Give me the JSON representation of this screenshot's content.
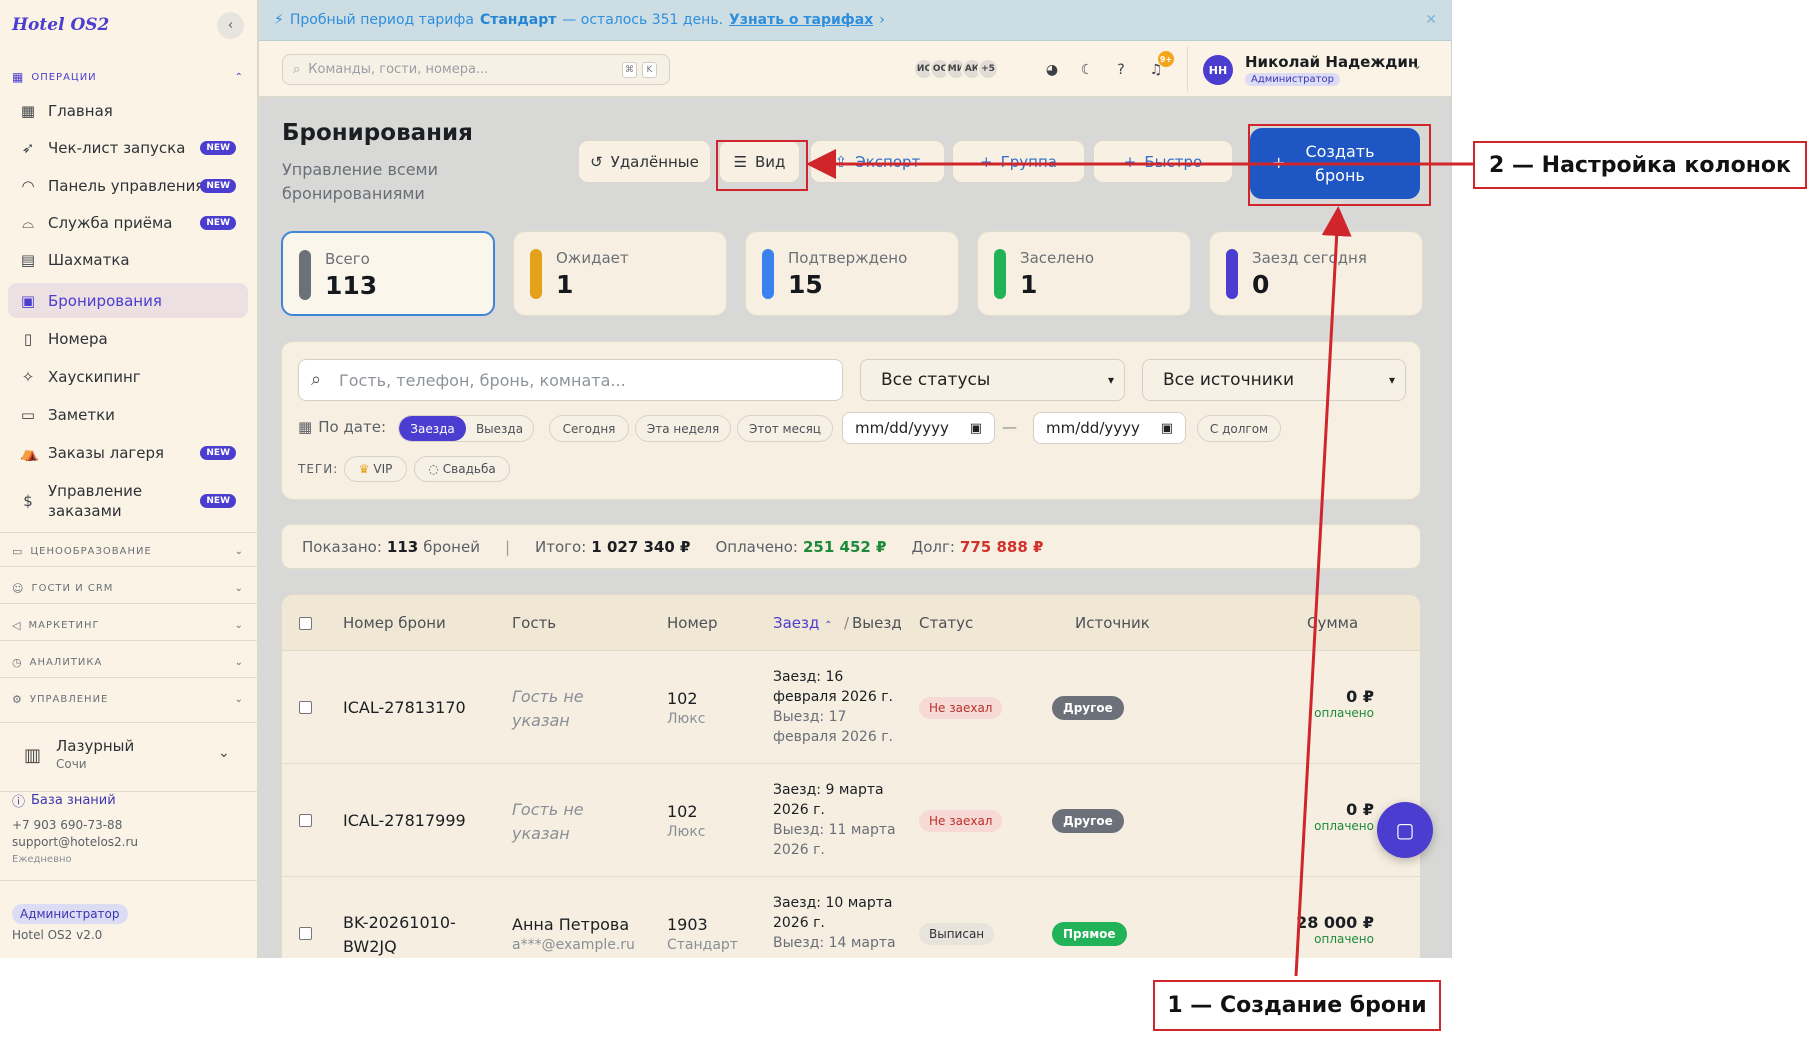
{
  "app": {
    "logo": "Hotel OS2",
    "version": "Hotel OS2 v2.0"
  },
  "sidebar": {
    "section_operations": "ОПЕРАЦИИ",
    "items": [
      {
        "label": "Главная",
        "icon": "grid-icon",
        "new": false
      },
      {
        "label": "Чек-лист запуска",
        "icon": "rocket-icon",
        "new": true
      },
      {
        "label": "Панель управления",
        "icon": "gauge-icon",
        "new": true
      },
      {
        "label": "Служба приёма",
        "icon": "bell-icon",
        "new": true
      },
      {
        "label": "Шахматка",
        "icon": "table-icon",
        "new": false
      },
      {
        "label": "Бронирования",
        "icon": "clipboard-icon",
        "new": false
      },
      {
        "label": "Номера",
        "icon": "door-icon",
        "new": false
      },
      {
        "label": "Хаускипинг",
        "icon": "sparkle-icon",
        "new": false
      },
      {
        "label": "Заметки",
        "icon": "note-icon",
        "new": false
      },
      {
        "label": "Заказы лагеря",
        "icon": "tent-icon",
        "new": true
      },
      {
        "label": "Управление заказами",
        "icon": "receipt-icon",
        "new": true
      }
    ],
    "new_badge": "NEW",
    "sections": [
      "ЦЕНООБРАЗОВАНИЕ",
      "ГОСТИ И CRM",
      "МАРКЕТИНГ",
      "АНАЛИТИКА",
      "УПРАВЛЕНИЕ"
    ],
    "hotel_name": "Лазурный",
    "hotel_city": "Сочи",
    "kb_label": "База знаний",
    "phone": "+7 903 690-73-88",
    "email": "support@hotelos2.ru",
    "hours": "Ежедневно",
    "role": "Администратор"
  },
  "trial": {
    "text": "Пробный период тарифа",
    "plan": "Стандарт",
    "rest": "— осталось 351 день.",
    "link": "Узнать о тарифах"
  },
  "topbar": {
    "command_placeholder": "Команды, гости, номера...",
    "kbd1": "⌘",
    "kbd2": "K",
    "avatars": [
      "ИС",
      "ОС",
      "МИ",
      "АК",
      "+5"
    ],
    "notif_count": "9+",
    "user_initials": "НН",
    "user_name": "Николай Надеждин",
    "user_role": "Администратор"
  },
  "page": {
    "title": "Бронирования",
    "subtitle": "Управление всеми бронированиями",
    "btn_deleted": "Удалённые",
    "btn_view": "Вид",
    "btn_export": "Экспорт",
    "btn_group": "Группа",
    "btn_quick": "Быстро",
    "btn_create": "Создать бронь"
  },
  "stats": [
    {
      "label": "Всего",
      "value": "113",
      "color": "#6b7079"
    },
    {
      "label": "Ожидает",
      "value": "1",
      "color": "#e3a21a"
    },
    {
      "label": "Подтверждено",
      "value": "15",
      "color": "#3b82f0"
    },
    {
      "label": "Заселено",
      "value": "1",
      "color": "#22b257"
    },
    {
      "label": "Заезд сегодня",
      "value": "0",
      "color": "#4b3dcf"
    }
  ],
  "filters": {
    "search_placeholder": "Гость, телефон, бронь, комната...",
    "status": "Все статусы",
    "source": "Все источники",
    "by_date": "По дате:",
    "seg_in": "Заезда",
    "seg_out": "Выезда",
    "today": "Сегодня",
    "week": "Эта неделя",
    "month": "Этот месяц",
    "date_from": "mm/dd/yyyy",
    "date_to": "mm/dd/yyyy",
    "debt": "С долгом",
    "tags_label": "ТЕГИ:",
    "tag_vip": "VIP",
    "tag_wedding": "Свадьба"
  },
  "summary": {
    "shown_label": "Показано:",
    "shown_count": "113",
    "shown_unit": "броней",
    "total_label": "Итого:",
    "total": "1 027 340 ₽",
    "paid_label": "Оплачено:",
    "paid": "251 452 ₽",
    "debt_label": "Долг:",
    "debt": "775 888 ₽"
  },
  "table": {
    "headers": {
      "number": "Номер брони",
      "guest": "Гость",
      "room": "Номер",
      "checkin": "Заезд",
      "checkout": "Выезд",
      "status": "Статус",
      "source": "Источник",
      "sum": "Сумма"
    },
    "rows": [
      {
        "id": "ICAL-27813170",
        "guest": "Гость не указан",
        "guest_sub": "",
        "room": "102",
        "room_type": "Люкс",
        "in": "Заезд: 16 февраля 2026 г.",
        "out": "Выезд: 17 февраля 2026 г.",
        "status": "Не заехал",
        "source": "Другое",
        "sum": "0 ₽",
        "paid": "оплачено"
      },
      {
        "id": "ICAL-27817999",
        "guest": "Гость не указан",
        "guest_sub": "",
        "room": "102",
        "room_type": "Люкс",
        "in": "Заезд: 9 марта 2026 г.",
        "out": "Выезд: 11 марта 2026 г.",
        "status": "Не заехал",
        "source": "Другое",
        "sum": "0 ₽",
        "paid": "оплачено"
      },
      {
        "id": "BK-20261010-BW2JQ",
        "guest": "Анна Петрова",
        "guest_sub": "a***@example.ru",
        "room": "1903",
        "room_type": "Стандарт",
        "in": "Заезд: 10 марта 2026 г.",
        "out": "Выезд: 14 марта",
        "status": "Выписан",
        "source": "Прямое",
        "sum": "28 000 ₽",
        "paid": "оплачено"
      }
    ]
  },
  "annotations": {
    "callout_1": "1 — Создание брони",
    "callout_2": "2 — Настройка колонок",
    "color": "#d0262b"
  }
}
